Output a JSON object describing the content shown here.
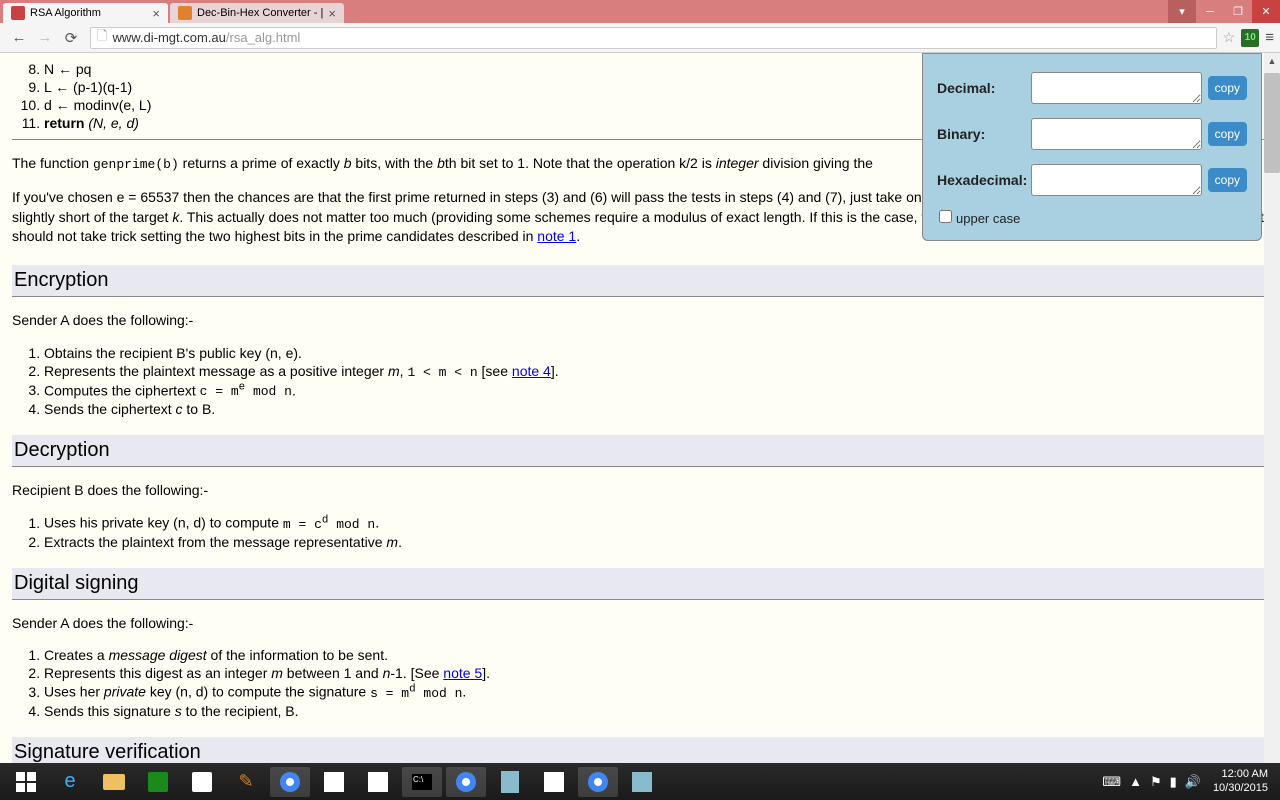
{
  "tabs": [
    {
      "title": "RSA Algorithm",
      "active": true
    },
    {
      "title": "Dec-Bin-Hex Converter - |",
      "active": false
    }
  ],
  "url": {
    "domain": "www.di-mgt.com.au",
    "path": "/rsa_alg.html"
  },
  "code_steps": [
    {
      "num": "8.",
      "text": "N ← pq"
    },
    {
      "num": "9.",
      "text": "L ← (p-1)(q-1)"
    },
    {
      "num": "10.",
      "text": "d ← modinv(e, L)"
    },
    {
      "num": "11.",
      "text_prefix": "return ",
      "text_em": "(N, e, d)"
    }
  ],
  "para1_parts": [
    "The function ",
    "genprime(b)",
    " returns a prime of exactly ",
    "b",
    " bits, with the ",
    "b",
    "th bit set to 1. Note that the operation k/2 is ",
    "integer",
    " division giving the"
  ],
  "para2": "If you've chosen e = 65537 then the chances are that the first prime returned in steps (3) and (6) will pass the tests in steps (4) and (7), just take one iteration. The final value of N may have a bit length slightly short of the target ",
  "para2_k": "k",
  "para2_cont": ". This actually does not matter too much (providing some schemes require a modulus of exact length. If this is the case, then just repeat the entire algorithm until you get one. It should not take trick setting the two highest bits in the prime candidates described in ",
  "note1": "note 1",
  "headings": {
    "encryption": "Encryption",
    "decryption": "Decryption",
    "signing": "Digital signing",
    "verification": "Signature verification"
  },
  "enc_intro": "Sender A does the following:-",
  "enc_steps": [
    "Obtains the recipient B's public key (n, e).",
    "Represents the plaintext message as a positive integer m, 1 < m < n [see note 4].",
    "Computes the ciphertext c = m^e mod n.",
    "Sends the ciphertext c to B."
  ],
  "dec_intro": "Recipient B does the following:-",
  "dec_steps": [
    "Uses his private key (n, d) to compute m = c^d mod n.",
    "Extracts the plaintext from the message representative m."
  ],
  "sign_intro": "Sender A does the following:-",
  "sign_steps": [
    "Creates a message digest of the information to be sent.",
    "Represents this digest as an integer m between 1 and n-1. [See note 5].",
    "Uses her private key (n, d) to compute the signature s = m^d mod n.",
    "Sends this signature s to the recipient, B."
  ],
  "popup": {
    "decimal": "Decimal:",
    "binary": "Binary:",
    "hex": "Hexadecimal:",
    "copy": "copy",
    "upper": "upper case"
  },
  "clock": {
    "time": "12:00 AM",
    "date": "10/30/2015"
  },
  "ext_badge": "10"
}
